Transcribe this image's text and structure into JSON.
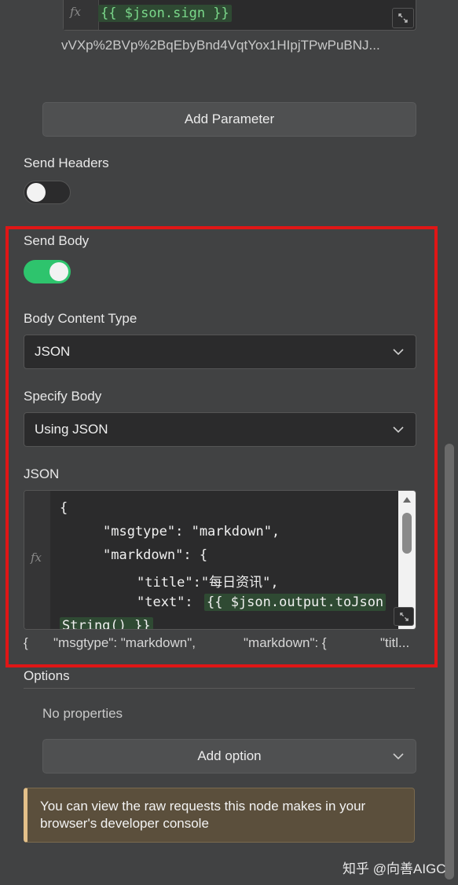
{
  "query_param": {
    "expression": "{{ $json.sign }}",
    "preview": "vVXp%2BVp%2BqEbyBnd4VqtYox1HIpjTPwPuBNJ..."
  },
  "add_parameter_label": "Add Parameter",
  "send_headers": {
    "label": "Send Headers",
    "enabled": false
  },
  "send_body": {
    "label": "Send Body",
    "enabled": true
  },
  "body_content_type": {
    "label": "Body Content Type",
    "value": "JSON"
  },
  "specify_body": {
    "label": "Specify Body",
    "value": "Using JSON"
  },
  "json_field": {
    "label": "JSON",
    "lines": [
      "{",
      "\"msgtype\": \"markdown\",",
      "\"markdown\": {",
      "\"title\":\"每日资讯\",",
      "\"text\": "
    ],
    "expr_part1": "{{ $json.output.toJson",
    "expr_part2": "String() }}",
    "preview_1": "{",
    "preview_2": "\"msgtype\": \"markdown\",",
    "preview_3": "\"markdown\": {",
    "preview_4": "\"titl..."
  },
  "options": {
    "label": "Options",
    "empty_text": "No properties",
    "add_option_label": "Add option"
  },
  "info_text": "You can view the raw requests this node makes in your browser's developer console",
  "watermark": "知乎 @向善AIGC",
  "colors": {
    "toggle_on": "#2ec46d",
    "toggle_off": "#2b2b2c",
    "highlight": "#e01616",
    "expression_green": "#7bd98b"
  }
}
